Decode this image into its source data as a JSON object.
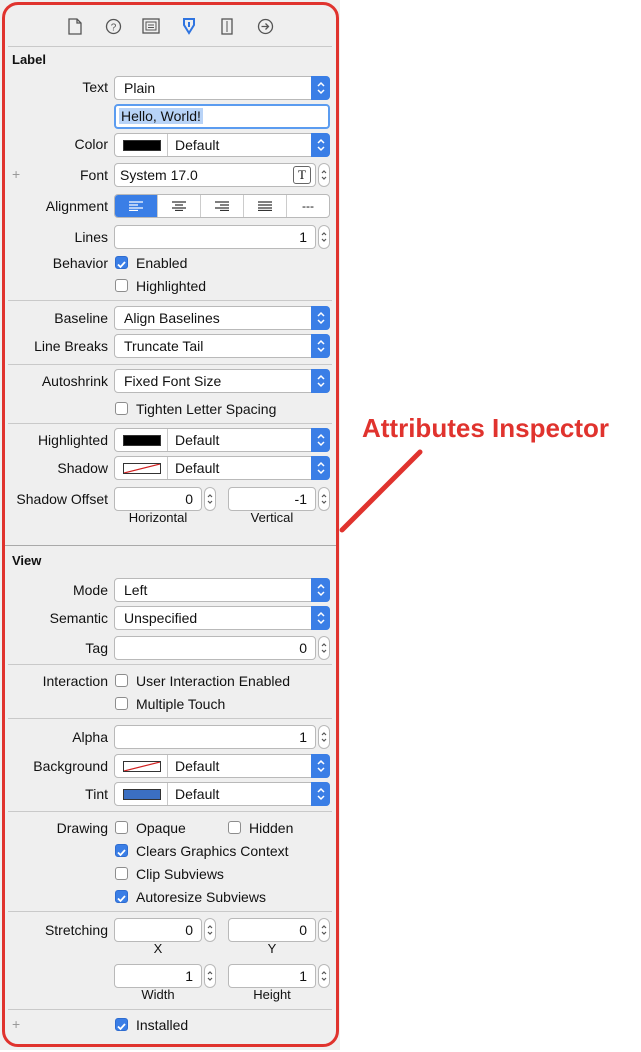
{
  "toolbar": {
    "icons": [
      "file-inspector-icon",
      "quick-help-icon",
      "identity-inspector-icon",
      "attributes-inspector-icon",
      "size-inspector-icon",
      "connections-inspector-icon"
    ]
  },
  "label_section": {
    "title": "Label",
    "text_label": "Text",
    "text_value": "Plain",
    "text_field": "Hello, World!",
    "color_label": "Color",
    "color_value": "Default",
    "font_label": "Font",
    "font_value": "System 17.0",
    "alignment_label": "Alignment",
    "alignment_more": "---",
    "lines_label": "Lines",
    "lines_value": "1",
    "behavior_label": "Behavior",
    "enabled": "Enabled",
    "highlighted": "Highlighted",
    "baseline_label": "Baseline",
    "baseline_value": "Align Baselines",
    "linebreaks_label": "Line Breaks",
    "linebreaks_value": "Truncate Tail",
    "autoshrink_label": "Autoshrink",
    "autoshrink_value": "Fixed Font Size",
    "tighten": "Tighten Letter Spacing",
    "highlighted_label": "Highlighted",
    "highlighted_value": "Default",
    "shadow_label": "Shadow",
    "shadow_value": "Default",
    "shadow_offset_label": "Shadow Offset",
    "shadow_h": "0",
    "shadow_v": "-1",
    "horizontal": "Horizontal",
    "vertical": "Vertical"
  },
  "view_section": {
    "title": "View",
    "mode_label": "Mode",
    "mode_value": "Left",
    "semantic_label": "Semantic",
    "semantic_value": "Unspecified",
    "tag_label": "Tag",
    "tag_value": "0",
    "interaction_label": "Interaction",
    "user_interaction": "User Interaction Enabled",
    "multiple_touch": "Multiple Touch",
    "alpha_label": "Alpha",
    "alpha_value": "1",
    "background_label": "Background",
    "background_value": "Default",
    "tint_label": "Tint",
    "tint_value": "Default",
    "drawing_label": "Drawing",
    "opaque": "Opaque",
    "hidden": "Hidden",
    "clears": "Clears Graphics Context",
    "clip": "Clip Subviews",
    "autoresize": "Autoresize Subviews",
    "stretching_label": "Stretching",
    "stretch_x": "0",
    "stretch_y": "0",
    "x": "X",
    "y": "Y",
    "stretch_w": "1",
    "stretch_h": "1",
    "width": "Width",
    "height": "Height",
    "installed": "Installed"
  },
  "annotation": "Attributes Inspector",
  "colors": {
    "accent": "#3a7ee6",
    "annotation": "#e0332e",
    "tint_swatch": "#3b6fc2"
  }
}
